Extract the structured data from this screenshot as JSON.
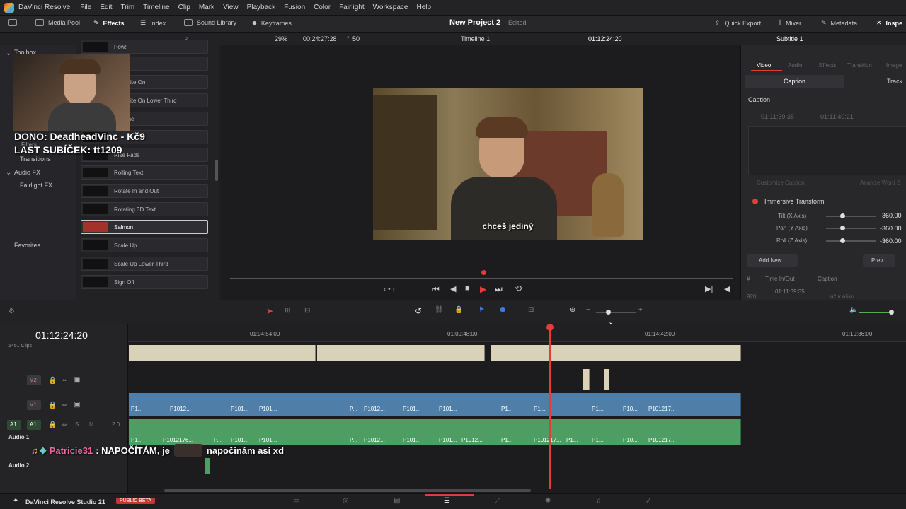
{
  "menu": {
    "app": "DaVinci Resolve",
    "items": [
      "File",
      "Edit",
      "Trim",
      "Timeline",
      "Clip",
      "Mark",
      "View",
      "Playback",
      "Fusion",
      "Color",
      "Fairlight",
      "Workspace",
      "Help"
    ]
  },
  "toolbar": {
    "media_pool": "Media Pool",
    "effects": "Effects",
    "index": "Index",
    "sound_library": "Sound Library",
    "keyframes": "Keyframes",
    "project": "New Project 2",
    "edited": "Edited",
    "quick_export": "Quick Export",
    "mixer": "Mixer",
    "metadata": "Metadata",
    "inspector": "Inspe"
  },
  "viewer_bar": {
    "zoom": "29%",
    "duration": "00:24:27:28",
    "fps": "50",
    "timeline_name": "Timeline 1",
    "timecode": "01:12:24:20",
    "subtitle": "Subtitle 1"
  },
  "left_panel": {
    "toolbox": "Toolbox",
    "filters": "Filters",
    "transitions": "Transitions",
    "audio_fx": "Audio FX",
    "fairlight_fx": "Fairlight FX",
    "favorites": "Favorites"
  },
  "overlay": {
    "dono": "DONO: DeadheadVinc - Kč9",
    "last_sub": "LAST SUBÍČEK: tt1209",
    "chat_user": "Patricie31",
    "chat_msg1": ": NAPOČÍTÁM, je",
    "chat_msg2": "napočinám asi xd"
  },
  "effects_list": [
    "Pow!",
    "ow",
    "ym Write On",
    "ym Write On Lower Third",
    "Chrome",
    "",
    "Rise Fade",
    "Rolling Text",
    "Rotate In and Out",
    "Rotating 3D Text",
    "Salmon",
    "Scale Up",
    "Scale Up Lower Third",
    "Sign Off"
  ],
  "video_subtitle": "chceš jediný",
  "inspector": {
    "tabs": [
      "Video",
      "Audio",
      "Effects",
      "Transition",
      "Image"
    ],
    "subtabs": [
      "Caption",
      "Track"
    ],
    "section": "Caption",
    "tc_in": "01:11:39:35",
    "tc_out": "01:11:40:21",
    "customize_caption": "Customize Caption",
    "analyze_word": "Analyze Word S",
    "immersive": "Immersive Transform",
    "tilt_label": "Tilt (X Axis)",
    "tilt_val": "-360.00",
    "pan_label": "Pan (Y Axis)",
    "pan_val": "-360.00",
    "roll_label": "Roll (Z Axis)",
    "roll_val": "-360.00",
    "add_new": "Add New",
    "prev": "Prev",
    "col_hash": "#",
    "col_time": "Time In/Out",
    "col_caption": "Caption",
    "row_num": "920",
    "row_tc": "01:11:39:35",
    "row_caption": "už v ášku."
  },
  "timeline": {
    "timecode": "01:12:24:20",
    "ruler": [
      "01:04:54:00",
      "01:09:48:00",
      "01:14:42:00",
      "01:19:36:00"
    ],
    "clips_count": "1451 Clips",
    "v2": "V2",
    "v1": "V1",
    "a1": "A1",
    "a1b": "A1",
    "level": "2.0",
    "s": "S",
    "m": "M",
    "audio1": "Audio 1",
    "audio2": "Audio 2",
    "v_labels": [
      "P1...",
      "P1012...",
      "P101...",
      "P101...",
      "P...",
      "P1012...",
      "P101...",
      "P101...",
      "P1...",
      "P1...",
      "P1...",
      "P10...",
      "P101217..."
    ],
    "a_labels": [
      "P1...",
      "P1012176...",
      "P...",
      "P101...",
      "P101...",
      "P...",
      "P1012...",
      "P101...",
      "P101...",
      "P1012...",
      "P1...",
      "P101217...",
      "P1...",
      "P1...",
      "P10...",
      "P101217..."
    ]
  },
  "bottom": {
    "app": "DaVinci Resolve Studio 21",
    "badge": "PUBLIC BETA"
  }
}
